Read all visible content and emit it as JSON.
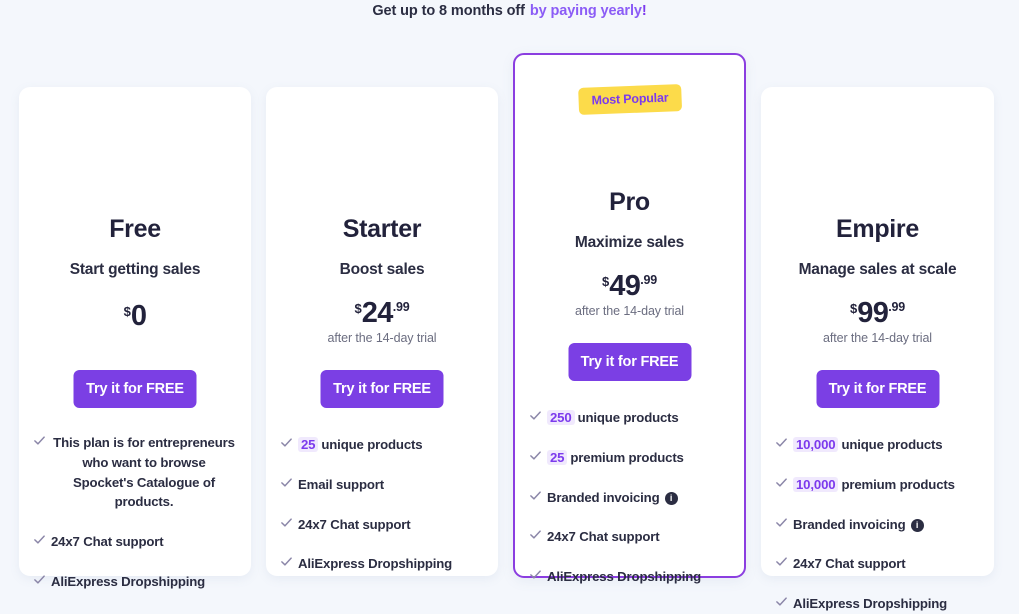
{
  "promo": {
    "lead": "Get up to 8 months off",
    "accent": "by paying yearly",
    "bang": "!"
  },
  "colors": {
    "page_background": "#f4f7fc",
    "card_background": "#ffffff",
    "accent_purple": "#7b3fe4",
    "highlight_border": "#8b3ee0",
    "badge_yellow": "#fcdb4a",
    "badge_text": "#7c3aed",
    "chip_background": "#f0e9fd",
    "chip_text": "#7c3aed",
    "text_dark": "#2b2d42",
    "text_muted": "#6b6d80",
    "check_color": "#8b86a8",
    "info_icon_background": "#2b2d42"
  },
  "plans": [
    {
      "id": "free",
      "name": "Free",
      "tagline": "Start getting sales",
      "currency": "$",
      "amount": "0",
      "cents": "",
      "price_note": "",
      "cta_label": "Try it for FREE",
      "badge": null,
      "features": [
        {
          "chip": "",
          "text": "This plan is for entrepreneurs who want to browse Spocket's Catalogue of products.",
          "info": false,
          "centered": true
        },
        {
          "chip": "",
          "text": "24x7 Chat support",
          "info": false,
          "centered": false
        },
        {
          "chip": "",
          "text": "AliExpress Dropshipping",
          "info": false,
          "centered": false
        }
      ]
    },
    {
      "id": "starter",
      "name": "Starter",
      "tagline": "Boost sales",
      "currency": "$",
      "amount": "24",
      "cents": ".99",
      "price_note": "after the 14-day trial",
      "cta_label": "Try it for FREE",
      "badge": null,
      "features": [
        {
          "chip": "25",
          "text": "unique products",
          "info": false,
          "centered": false
        },
        {
          "chip": "",
          "text": "Email support",
          "info": false,
          "centered": false
        },
        {
          "chip": "",
          "text": "24x7 Chat support",
          "info": false,
          "centered": false
        },
        {
          "chip": "",
          "text": "AliExpress Dropshipping",
          "info": false,
          "centered": false
        }
      ]
    },
    {
      "id": "pro",
      "name": "Pro",
      "tagline": "Maximize sales",
      "currency": "$",
      "amount": "49",
      "cents": ".99",
      "price_note": "after the 14-day trial",
      "cta_label": "Try it for FREE",
      "badge": "Most Popular",
      "features": [
        {
          "chip": "250",
          "text": "unique products",
          "info": false,
          "centered": false
        },
        {
          "chip": "25",
          "text": "premium products",
          "info": false,
          "centered": false
        },
        {
          "chip": "",
          "text": "Branded invoicing",
          "info": true,
          "centered": false
        },
        {
          "chip": "",
          "text": "24x7 Chat support",
          "info": false,
          "centered": false
        },
        {
          "chip": "",
          "text": "AliExpress Dropshipping",
          "info": false,
          "centered": false
        }
      ]
    },
    {
      "id": "empire",
      "name": "Empire",
      "tagline": "Manage sales at scale",
      "currency": "$",
      "amount": "99",
      "cents": ".99",
      "price_note": "after the 14-day trial",
      "cta_label": "Try it for FREE",
      "badge": null,
      "features": [
        {
          "chip": "10,000",
          "text": "unique products",
          "info": false,
          "centered": false
        },
        {
          "chip": "10,000",
          "text": "premium products",
          "info": false,
          "centered": false
        },
        {
          "chip": "",
          "text": "Branded invoicing",
          "info": true,
          "centered": false
        },
        {
          "chip": "",
          "text": "24x7 Chat support",
          "info": false,
          "centered": false
        },
        {
          "chip": "",
          "text": "AliExpress Dropshipping",
          "info": false,
          "centered": false
        }
      ]
    }
  ],
  "icons": {
    "check": "check-icon",
    "info": "info-icon"
  }
}
